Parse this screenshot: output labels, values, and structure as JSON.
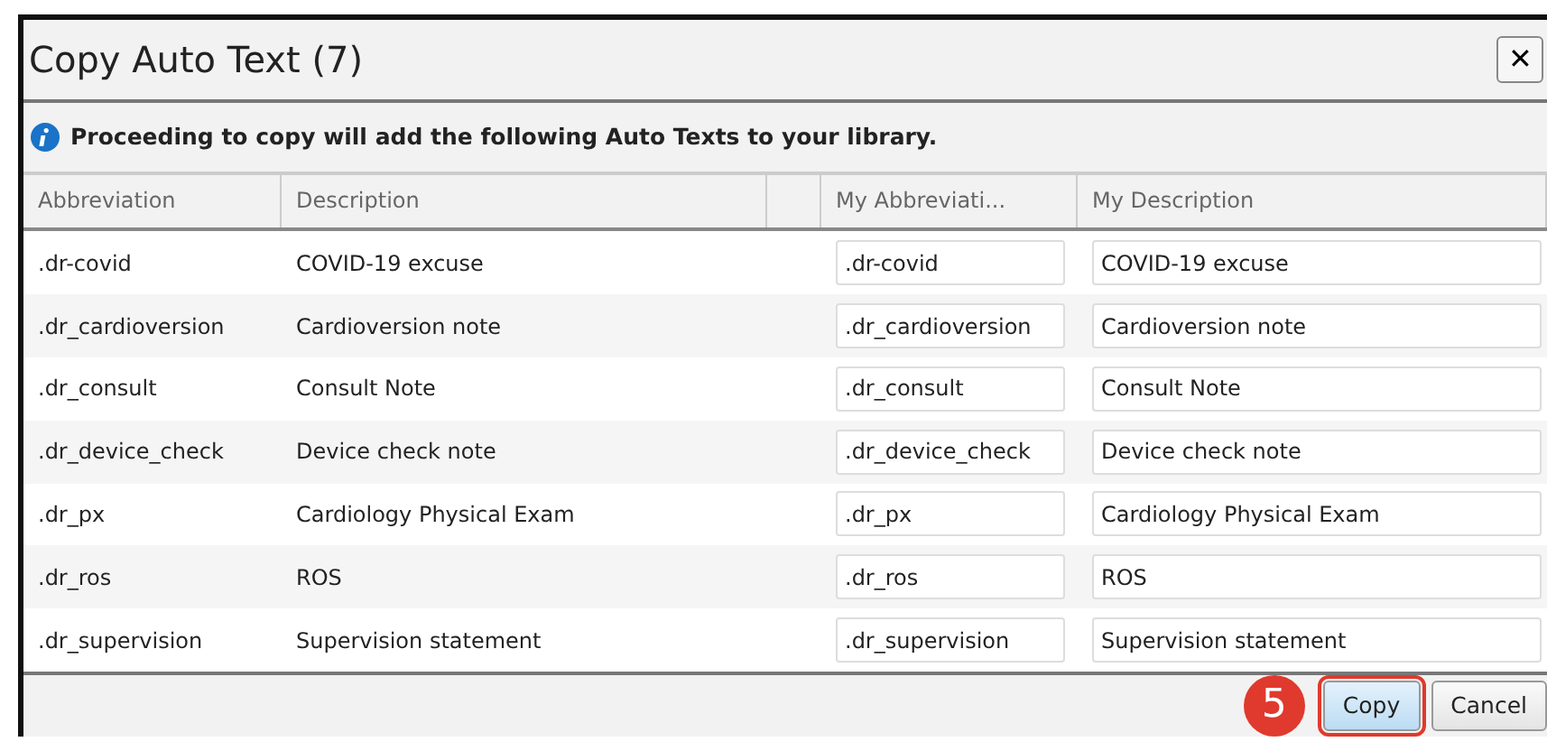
{
  "window": {
    "title": "Copy Auto Text (7)",
    "close": "✕"
  },
  "info": "Proceeding to copy will add the following Auto Texts to your library.",
  "table": {
    "columns": [
      "Abbreviation",
      "Description",
      "",
      "My Abbreviati...",
      "My Description"
    ],
    "rows": [
      {
        "abbreviation": ".dr-covid",
        "description": "COVID-19 excuse",
        "my_abbreviation": ".dr-covid",
        "my_description": "COVID-19 excuse"
      },
      {
        "abbreviation": ".dr_cardioversion",
        "description": "Cardioversion note",
        "my_abbreviation": ".dr_cardioversion",
        "my_description": "Cardioversion note"
      },
      {
        "abbreviation": ".dr_consult",
        "description": "Consult Note",
        "my_abbreviation": ".dr_consult",
        "my_description": "Consult Note"
      },
      {
        "abbreviation": ".dr_device_check",
        "description": "Device check note",
        "my_abbreviation": ".dr_device_check",
        "my_description": "Device check note"
      },
      {
        "abbreviation": ".dr_px",
        "description": "Cardiology Physical Exam",
        "my_abbreviation": ".dr_px",
        "my_description": "Cardiology Physical Exam"
      },
      {
        "abbreviation": ".dr_ros",
        "description": "ROS",
        "my_abbreviation": ".dr_ros",
        "my_description": "ROS"
      },
      {
        "abbreviation": ".dr_supervision",
        "description": "Supervision statement",
        "my_abbreviation": ".dr_supervision",
        "my_description": "Supervision statement"
      }
    ]
  },
  "step_badge": "5",
  "buttons": [
    {
      "label": "Copy",
      "highlighted": true
    },
    {
      "label": "Cancel",
      "highlighted": false
    }
  ]
}
